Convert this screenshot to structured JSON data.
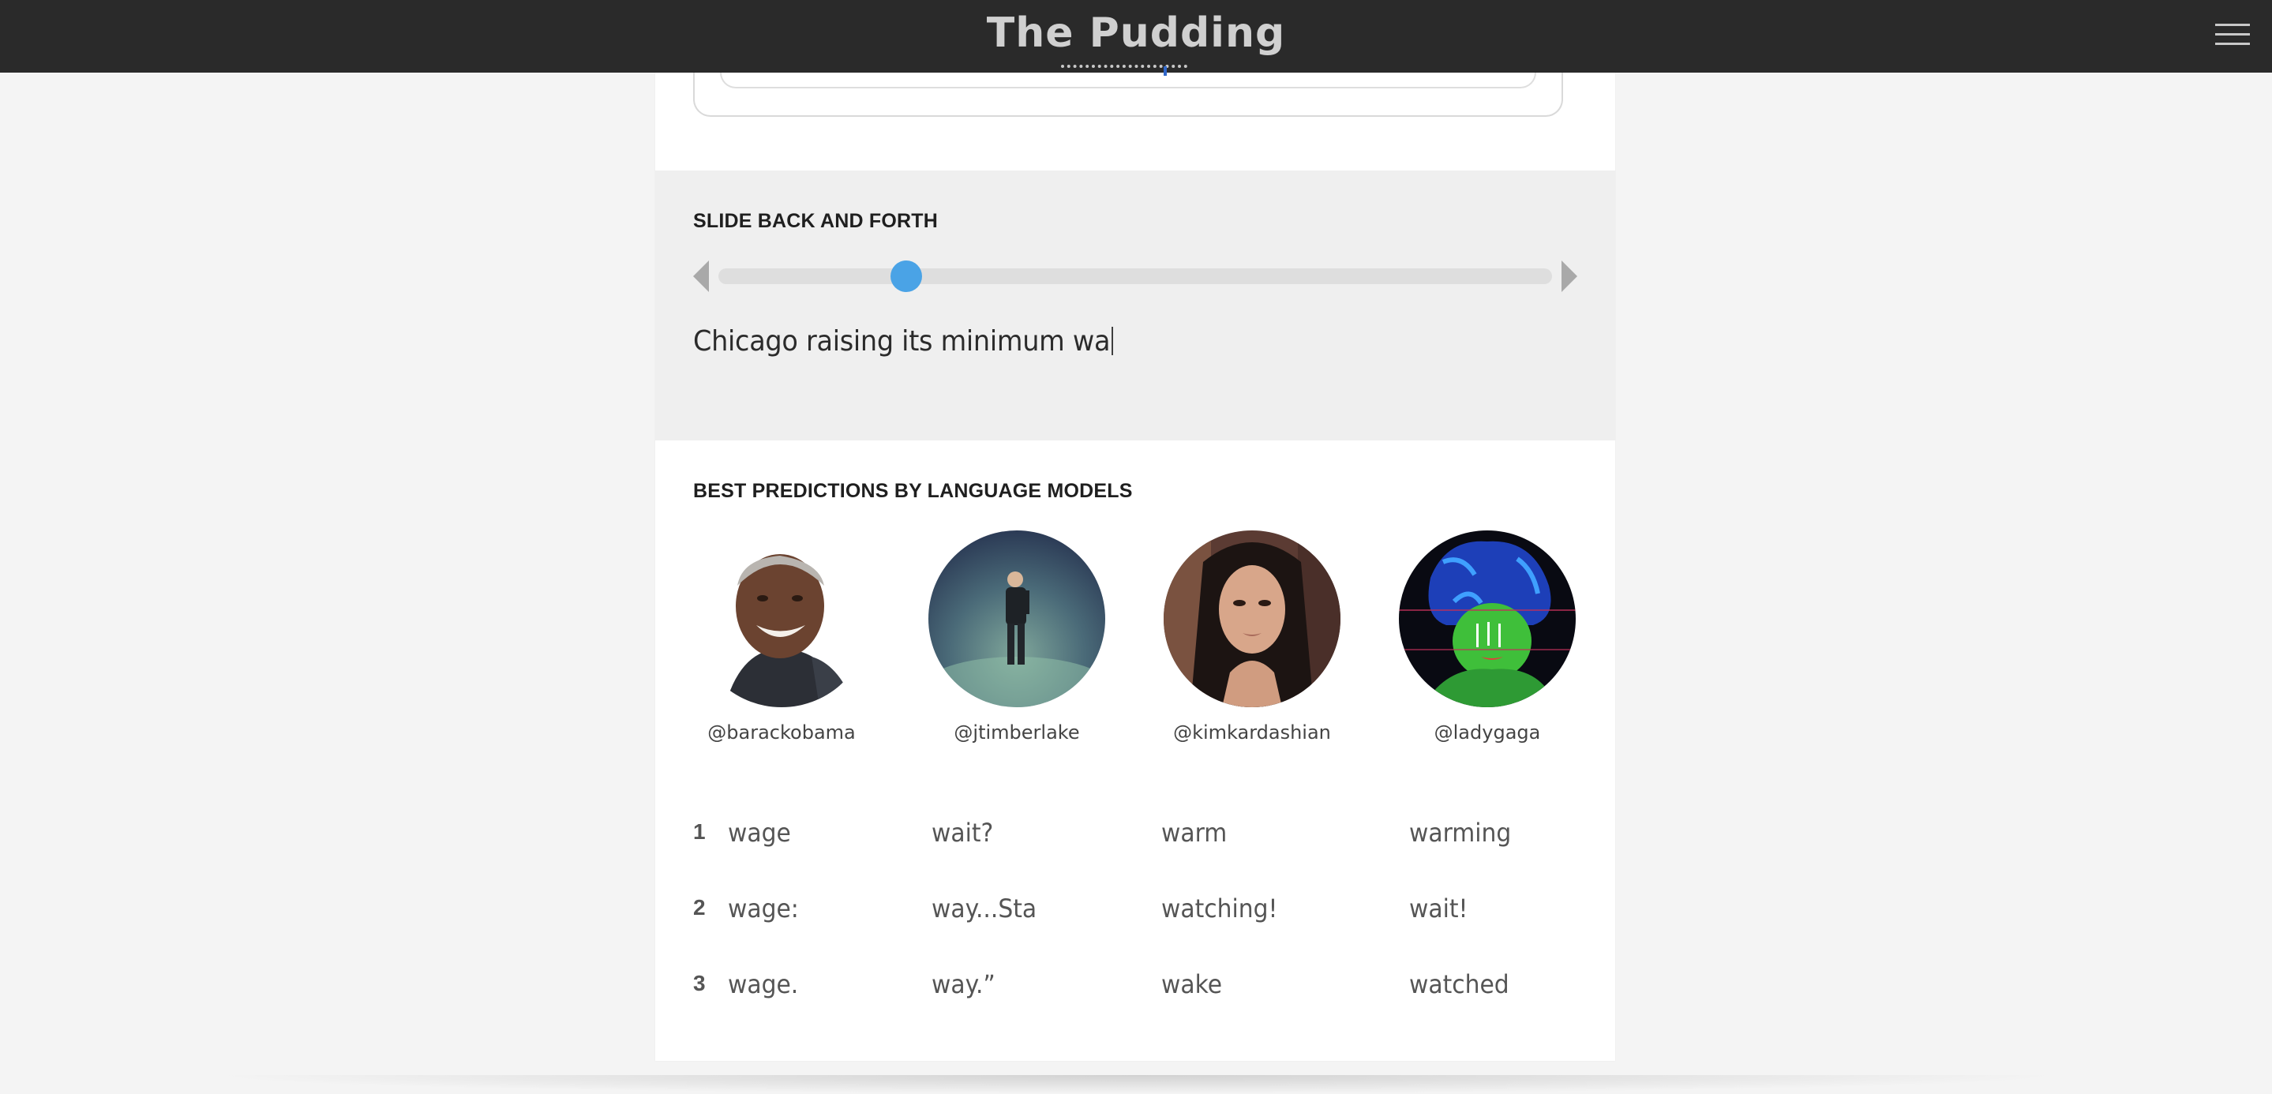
{
  "header": {
    "logo": "The Pudding",
    "menu_icon": "hamburger-menu-icon"
  },
  "slider": {
    "title": "SLIDE BACK AND FORTH",
    "position_fraction": 0.225,
    "typed_text": "Chicago raising its minimum wa",
    "prev_icon": "triangle-left-icon",
    "next_icon": "triangle-right-icon"
  },
  "predictions": {
    "title": "BEST PREDICTIONS BY LANGUAGE MODELS",
    "models": [
      {
        "handle": "@barackobama"
      },
      {
        "handle": "@jtimberlake"
      },
      {
        "handle": "@kimkardashian"
      },
      {
        "handle": "@ladygaga"
      }
    ],
    "ranks": [
      "1",
      "2",
      "3"
    ],
    "rows": [
      [
        "wage",
        "wait?",
        "warm",
        "warming"
      ],
      [
        "wage:",
        "way...Sta",
        "watching!",
        "wait!"
      ],
      [
        "wage.",
        "way.”",
        "wake",
        "watched"
      ]
    ]
  },
  "colors": {
    "header_bg": "#2a2a2a",
    "accent": "#4aa3e6",
    "section_bg": "#efefef"
  }
}
